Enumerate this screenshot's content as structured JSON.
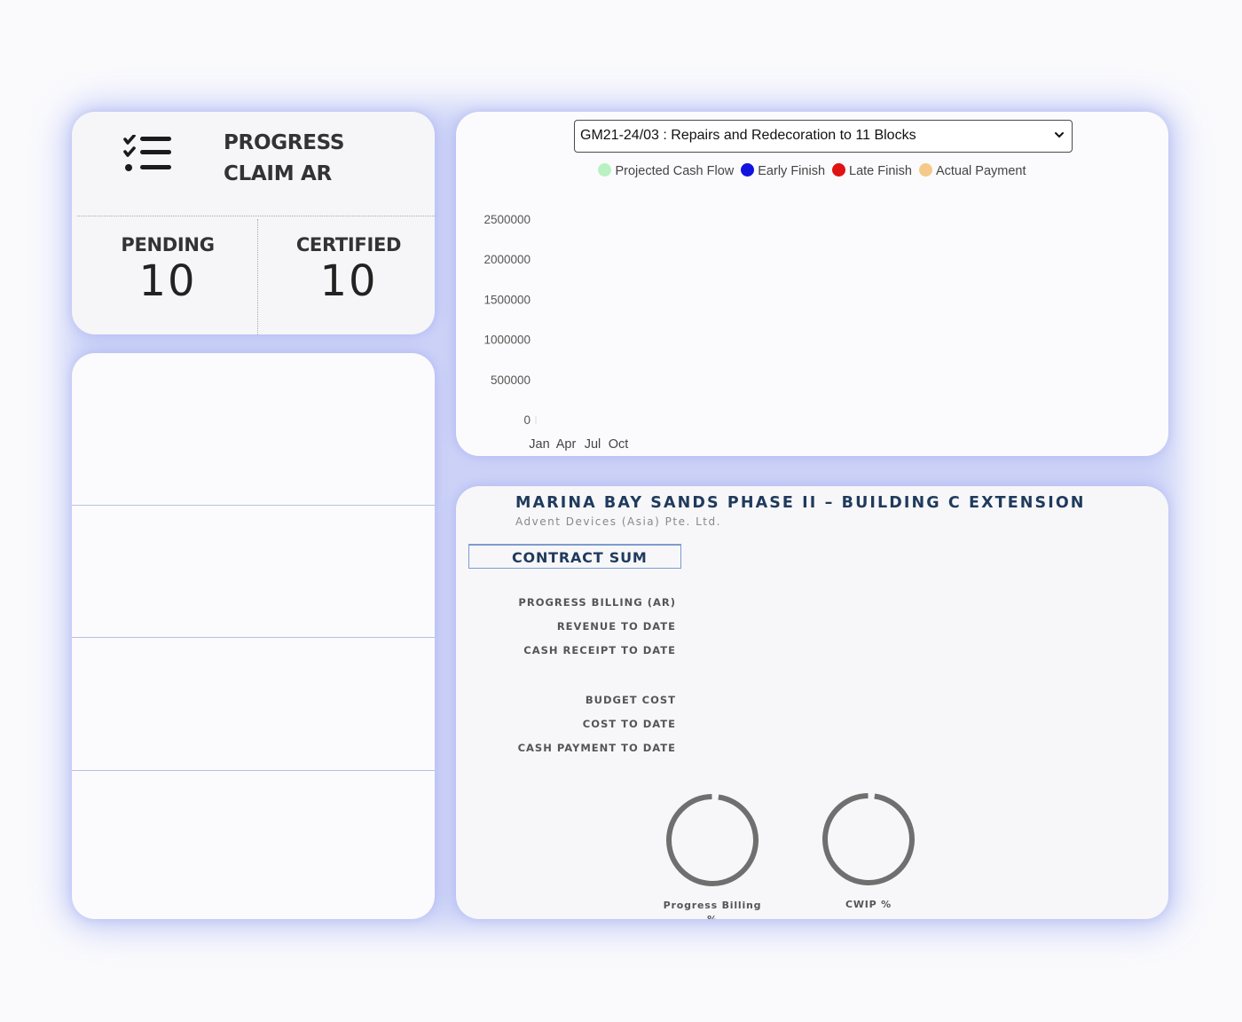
{
  "claim_card": {
    "title": "PROGRESS CLAIM AR",
    "icon": "checklist-icon",
    "pending_label": "PENDING",
    "pending_value": "10",
    "certified_label": "CERTIFIED",
    "certified_value": "10"
  },
  "chart_panel": {
    "selected_project": "GM21-24/03 : Repairs and Redecoration to 11 Blocks"
  },
  "chart_data": {
    "type": "line",
    "legend": [
      {
        "name": "Projected Cash Flow",
        "color": "#b9f2c1"
      },
      {
        "name": "Early Finish",
        "color": "#1212e0"
      },
      {
        "name": "Late Finish",
        "color": "#e01212"
      },
      {
        "name": "Actual Payment",
        "color": "#f5c98a"
      }
    ],
    "x_ticks": [
      "Jan",
      "Apr",
      "Jul",
      "Oct"
    ],
    "y_ticks": [
      "2500000",
      "2000000",
      "1500000",
      "1000000",
      "500000",
      "0"
    ],
    "ylim": [
      0,
      2500000
    ],
    "series": []
  },
  "project": {
    "title": "MARINA BAY SANDS PHASE II – BUILDING C EXTENSION",
    "subtitle": "Advent Devices (Asia) Pte. Ltd.",
    "section": "CONTRACT SUM",
    "metrics_ar": [
      "PROGRESS BILLING (AR)",
      "REVENUE TO DATE",
      "CASH RECEIPT TO DATE"
    ],
    "metrics_cost": [
      "BUDGET COST",
      "COST TO DATE",
      "CASH PAYMENT TO DATE"
    ],
    "gauges": [
      {
        "label": "Progress Billing",
        "label2": "%"
      },
      {
        "label": "CWIP %"
      }
    ]
  }
}
